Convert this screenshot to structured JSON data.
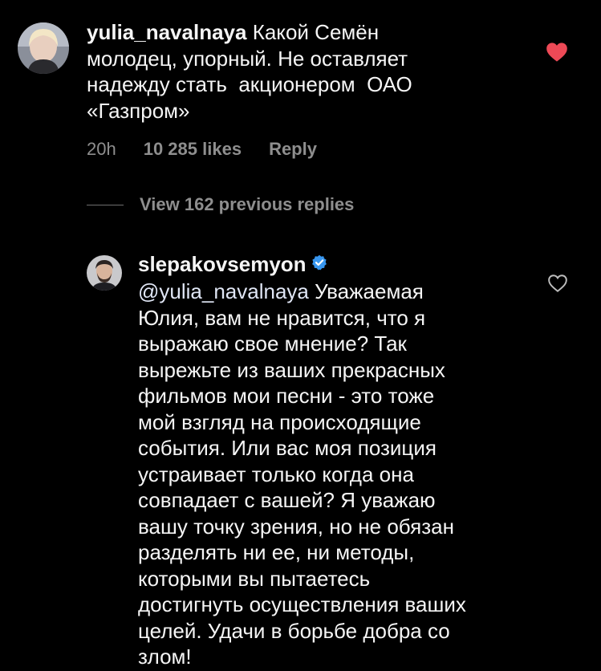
{
  "comment": {
    "username": "yulia_navalnaya",
    "text": " Какой Семён\nмолодец, упорный. Не оставляет\nнадежду стать  акционером  ОАО\n«Газпром»",
    "time": "20h",
    "likes": "10 285 likes",
    "reply_label": "Reply",
    "liked": true,
    "heart_icon": "heart-filled-icon",
    "heart_color": "#ed4956"
  },
  "view_replies": {
    "label": "View 162 previous replies"
  },
  "reply": {
    "username": "slepakovsemyon",
    "verified": true,
    "verified_color": "#3897f0",
    "mention": "@yulia_navalnaya",
    "text": " Уважаемая\nЮлия, вам не нравится, что я\nвыражаю свое мнение? Так\nвырежьте из ваших прекрасных\nфильмов мои песни - это тоже\nмой взгляд на происходящие\nсобытия. Или вас моя позиция\nустраивает только когда она\nсовпадает с вашей? Я уважаю\nвашу точку зрения, но не обязан\nразделять ни ее, ни методы,\nкоторыми вы пытаетесь\nдостигнуть осуществления ваших\nцелей. Удачи в борьбе добра со\nзлом!",
    "liked": false,
    "heart_icon": "heart-outline-icon"
  }
}
